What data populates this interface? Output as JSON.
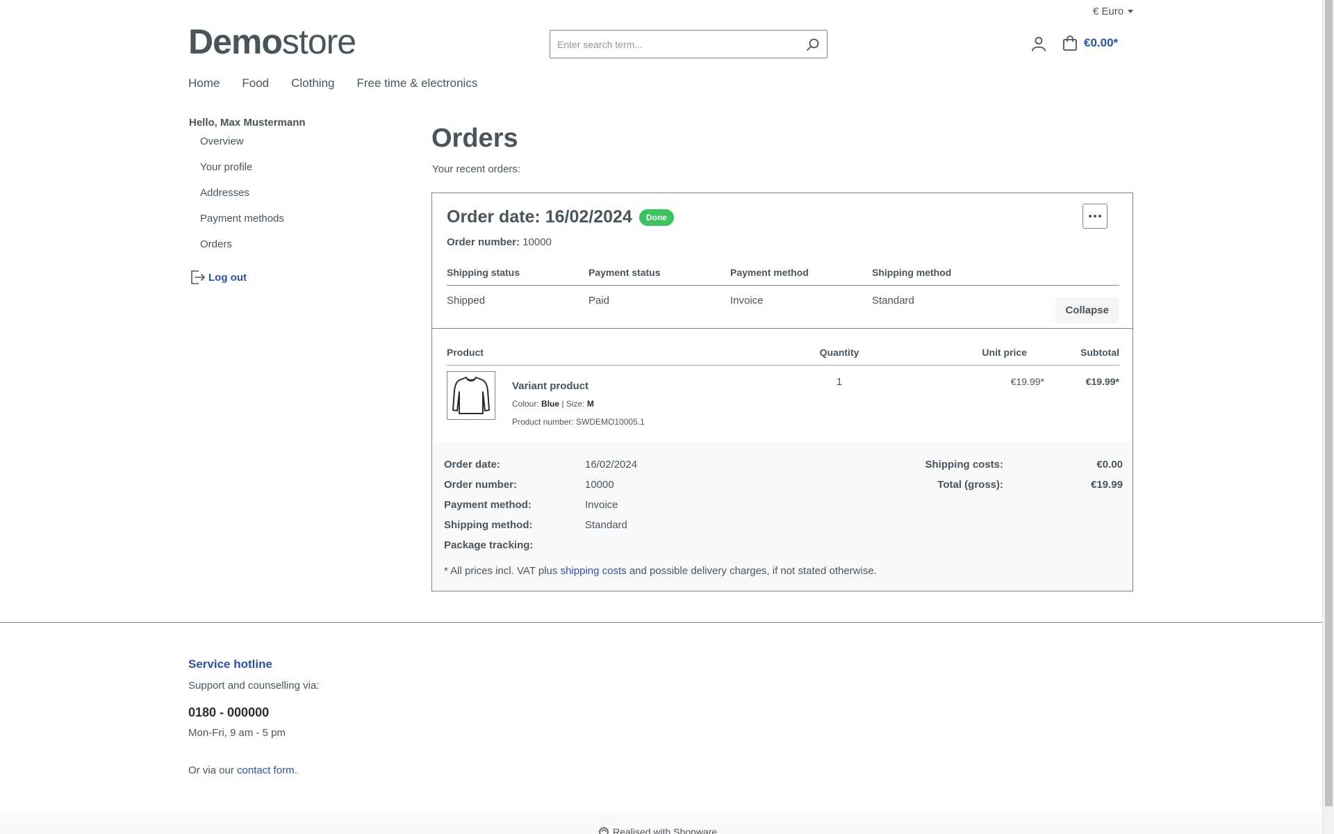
{
  "header": {
    "currency": "€ Euro",
    "logo_bold": "Demo",
    "logo_light": "store",
    "search_placeholder": "Enter search term...",
    "cart_total": "€0.00*"
  },
  "nav": {
    "items": [
      "Home",
      "Food",
      "Clothing",
      "Free time & electronics"
    ]
  },
  "sidebar": {
    "greeting": "Hello, Max Mustermann",
    "items": [
      "Overview",
      "Your profile",
      "Addresses",
      "Payment methods",
      "Orders"
    ],
    "logout": "Log out"
  },
  "main": {
    "title": "Orders",
    "subtitle": "Your recent orders:"
  },
  "order": {
    "date_label": "Order date: 16/02/2024",
    "status_badge": "Done",
    "number_label": "Order number:",
    "number": "10000",
    "status_headers": [
      "Shipping status",
      "Payment status",
      "Payment method",
      "Shipping method"
    ],
    "status_values": [
      "Shipped",
      "Paid",
      "Invoice",
      "Standard"
    ],
    "collapse": "Collapse",
    "items_headers": {
      "product": "Product",
      "quantity": "Quantity",
      "unit_price": "Unit price",
      "subtotal": "Subtotal"
    },
    "line_item": {
      "name": "Variant product",
      "colour_label": "Colour:",
      "colour": "Blue",
      "size_label": "Size:",
      "size": "M",
      "product_number": "Product number: SWDEMO10005.1",
      "quantity": "1",
      "unit_price": "€19.99*",
      "subtotal": "€19.99*"
    },
    "summary": {
      "rows": [
        {
          "k": "Order date:",
          "v": "16/02/2024"
        },
        {
          "k": "Order number:",
          "v": "10000"
        },
        {
          "k": "Payment method:",
          "v": "Invoice"
        },
        {
          "k": "Shipping method:",
          "v": "Standard"
        },
        {
          "k": "Package tracking:",
          "v": ""
        }
      ],
      "shipping_costs_label": "Shipping costs:",
      "shipping_costs": "€0.00",
      "total_label": "Total (gross):",
      "total": "€19.99",
      "disclaimer_pre": "* All prices incl. VAT plus",
      "disclaimer_link": "shipping costs",
      "disclaimer_post": "and possible delivery charges, if not stated otherwise."
    }
  },
  "footer": {
    "hotline_title": "Service hotline",
    "hotline_sub": "Support and counselling via:",
    "phone": "0180 - 000000",
    "hours": "Mon-Fri, 9 am - 5 pm",
    "contact_pre": "Or via our",
    "contact_link": "contact form",
    "contact_post": ".",
    "realised": "Realised with Shopware"
  }
}
